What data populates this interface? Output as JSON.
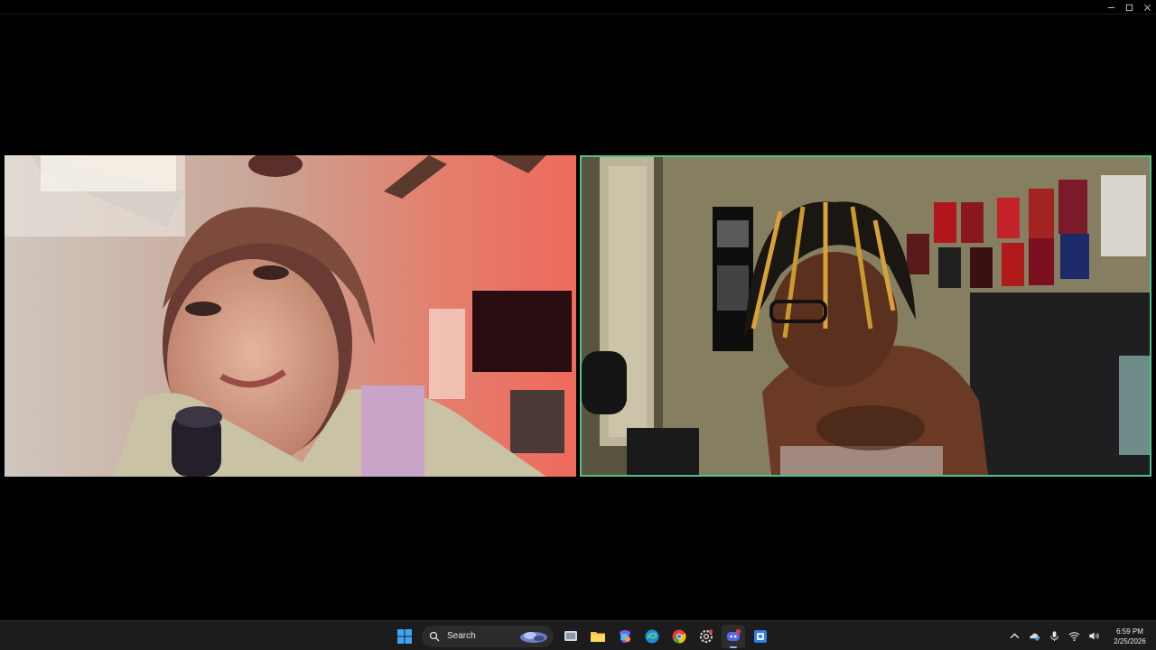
{
  "window": {
    "controls": [
      "minimize",
      "maximize",
      "close"
    ]
  },
  "participants": [
    {
      "position": "left",
      "speaking": false
    },
    {
      "position": "right",
      "speaking": true,
      "highlight_color": "#4cc38a"
    }
  ],
  "taskbar": {
    "search_label": "Search",
    "pinned_apps": [
      "start-icon",
      "search-box",
      "task-view-icon",
      "file-explorer-icon",
      "copilot-icon",
      "edge-icon",
      "chrome-icon",
      "settings-icon",
      "discord-icon",
      "app-icon"
    ],
    "discord_badge": "",
    "clock": {
      "time": "6:59 PM",
      "date": "2/25/2026"
    }
  },
  "colors": {
    "active_speaker_border": "#4cc38a",
    "taskbar_bg": "#1c1c1c",
    "windows_blue": "#0078d4"
  }
}
